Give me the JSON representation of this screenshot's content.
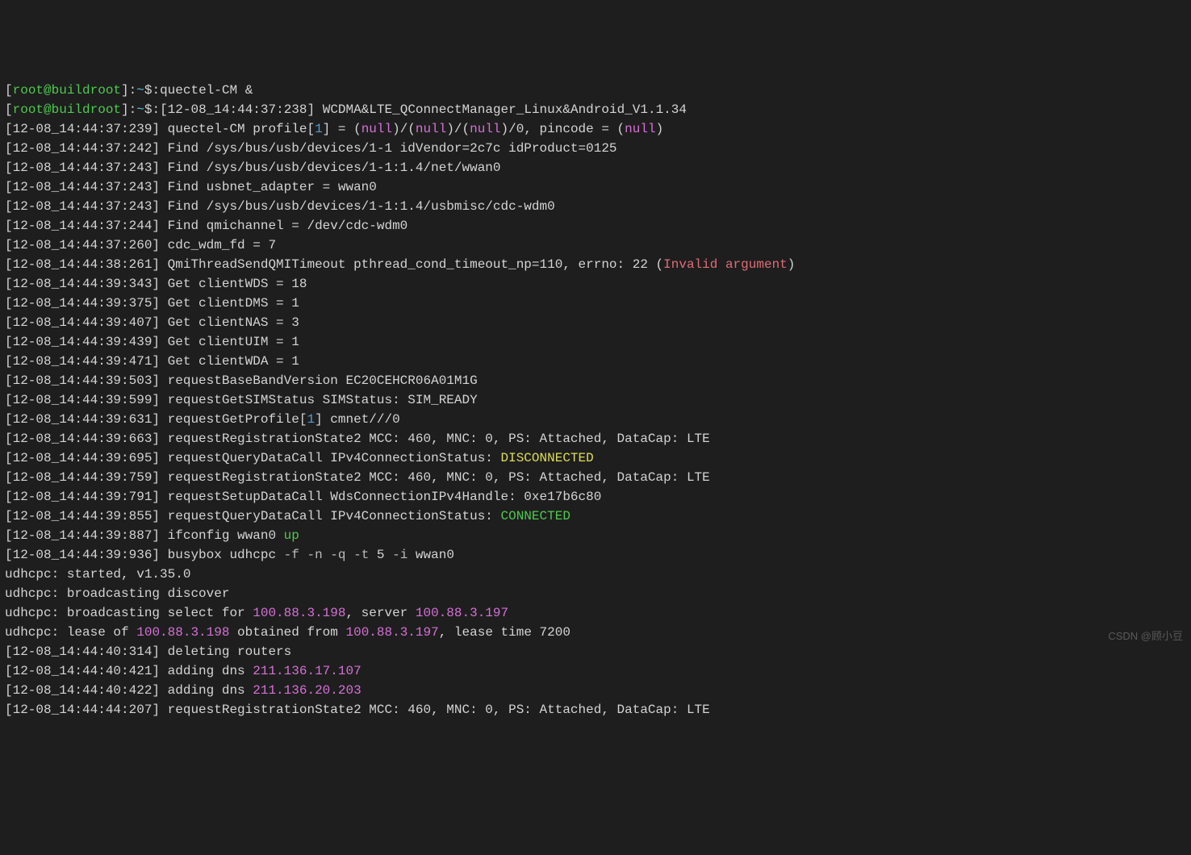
{
  "prompt": {
    "user_host_open": "[",
    "user": "root@buildroot",
    "user_host_close": "]",
    "path_sep": ":",
    "path": "~",
    "dollar": "$",
    "colon": ":"
  },
  "cmd1": "quectel-CM &",
  "cmd2_ts": "[12-08_14:44:37:238]",
  "cmd2_txt": " WCDMA&LTE_QConnectManager_Linux&Android_V1.1.34",
  "l3": {
    "ts": "[12-08_14:44:37:239]",
    "a": " quectel-CM profile[",
    "idx": "1",
    "b": "] = (",
    "n1": "null",
    "c": ")/(",
    "n2": "null",
    "d": ")/(",
    "n3": "null",
    "e": ")/0, pincode = (",
    "n4": "null",
    "f": ")"
  },
  "l4": {
    "ts": "[12-08_14:44:37:242]",
    "txt": " Find /sys/bus/usb/devices/1-1 idVendor=2c7c idProduct=0125"
  },
  "l5": {
    "ts": "[12-08_14:44:37:243]",
    "txt": " Find /sys/bus/usb/devices/1-1:1.4/net/wwan0"
  },
  "l6": {
    "ts": "[12-08_14:44:37:243]",
    "txt": " Find usbnet_adapter = wwan0"
  },
  "l7": {
    "ts": "[12-08_14:44:37:243]",
    "txt": " Find /sys/bus/usb/devices/1-1:1.4/usbmisc/cdc-wdm0"
  },
  "l8": {
    "ts": "[12-08_14:44:37:244]",
    "txt": " Find qmichannel = /dev/cdc-wdm0"
  },
  "l9": {
    "ts": "[12-08_14:44:37:260]",
    "txt": " cdc_wdm_fd = 7"
  },
  "l10": {
    "ts": "[12-08_14:44:38:261]",
    "a": " QmiThreadSendQMITimeout pthread_cond_timeout_np=110, errno: 22 (",
    "err": "Invalid argument",
    "b": ")"
  },
  "l11": {
    "ts": "[12-08_14:44:39:343]",
    "txt": " Get clientWDS = 18"
  },
  "l12": {
    "ts": "[12-08_14:44:39:375]",
    "txt": " Get clientDMS = 1"
  },
  "l13": {
    "ts": "[12-08_14:44:39:407]",
    "txt": " Get clientNAS = 3"
  },
  "l14": {
    "ts": "[12-08_14:44:39:439]",
    "txt": " Get clientUIM = 1"
  },
  "l15": {
    "ts": "[12-08_14:44:39:471]",
    "txt": " Get clientWDA = 1"
  },
  "l16": {
    "ts": "[12-08_14:44:39:503]",
    "txt": " requestBaseBandVersion EC20CEHCR06A01M1G"
  },
  "l17": {
    "ts": "[12-08_14:44:39:599]",
    "txt": " requestGetSIMStatus SIMStatus: SIM_READY"
  },
  "l18": {
    "ts": "[12-08_14:44:39:631]",
    "a": " requestGetProfile[",
    "idx": "1",
    "b": "] cmnet///0"
  },
  "l19": {
    "ts": "[12-08_14:44:39:663]",
    "txt": " requestRegistrationState2 MCC: 460, MNC: 0, PS: Attached, DataCap: LTE"
  },
  "l20": {
    "ts": "[12-08_14:44:39:695]",
    "a": " requestQueryDataCall IPv4ConnectionStatus: ",
    "status": "DISCONNECTED"
  },
  "l21": {
    "ts": "[12-08_14:44:39:759]",
    "txt": " requestRegistrationState2 MCC: 460, MNC: 0, PS: Attached, DataCap: LTE"
  },
  "l22": {
    "ts": "[12-08_14:44:39:791]",
    "txt": " requestSetupDataCall WdsConnectionIPv4Handle: 0xe17b6c80"
  },
  "l23": {
    "ts": "[12-08_14:44:39:855]",
    "a": " requestQueryDataCall IPv4ConnectionStatus: ",
    "status": "CONNECTED"
  },
  "l24": {
    "ts": "[12-08_14:44:39:887]",
    "a": " ifconfig wwan0 ",
    "up": "up"
  },
  "l25": {
    "ts": "[12-08_14:44:39:936]",
    "a": " busybox udhcpc ",
    "f1": "-f",
    "s1": " ",
    "f2": "-n",
    "s2": " ",
    "f3": "-q",
    "s3": " ",
    "f4": "-t",
    "s4": " 5 ",
    "f5": "-i",
    "s5": " wwan0"
  },
  "l26": "udhcpc: started, v1.35.0",
  "l27": "udhcpc: broadcasting discover",
  "l28": {
    "a": "udhcpc: broadcasting select for ",
    "ip1": "100.88.3.198",
    "b": ", server ",
    "ip2": "100.88.3.197"
  },
  "l29": {
    "a": "udhcpc: lease of ",
    "ip1": "100.88.3.198",
    "b": " obtained from ",
    "ip2": "100.88.3.197",
    "c": ", lease time 7200"
  },
  "l30": {
    "ts": "[12-08_14:44:40:314]",
    "txt": " deleting routers"
  },
  "l31": {
    "ts": "[12-08_14:44:40:421]",
    "a": " adding dns ",
    "ip": "211.136.17.107"
  },
  "l32": {
    "ts": "[12-08_14:44:40:422]",
    "a": " adding dns ",
    "ip": "211.136.20.203"
  },
  "l33": {
    "ts": "[12-08_14:44:44:207]",
    "txt": " requestRegistrationState2 MCC: 460, MNC: 0, PS: Attached, DataCap: LTE"
  },
  "watermark": "CSDN @顾小豆"
}
